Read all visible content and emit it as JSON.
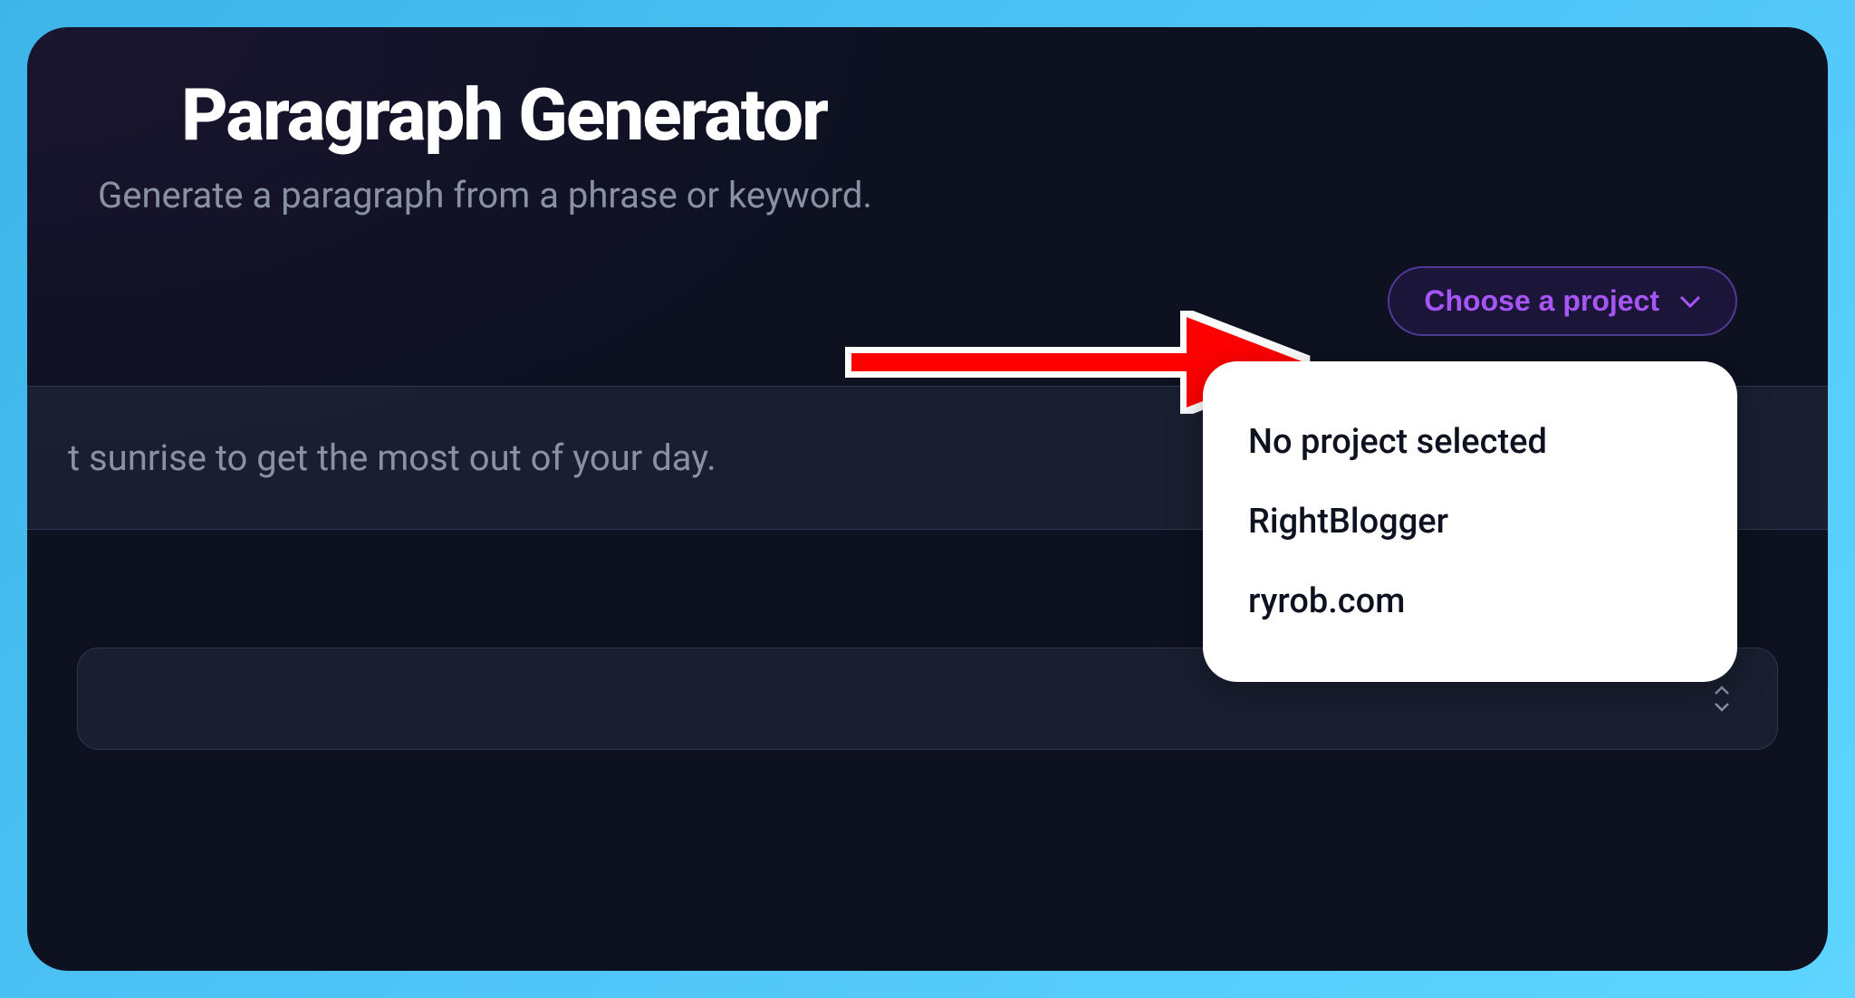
{
  "header": {
    "title": "Paragraph Generator",
    "subtitle": "Generate a paragraph from a phrase or keyword."
  },
  "project_selector": {
    "button_label": "Choose a project",
    "options": [
      "No project selected",
      "RightBlogger",
      "ryrob.com"
    ]
  },
  "input": {
    "visible_text": "t sunrise to get the most out of your day."
  }
}
